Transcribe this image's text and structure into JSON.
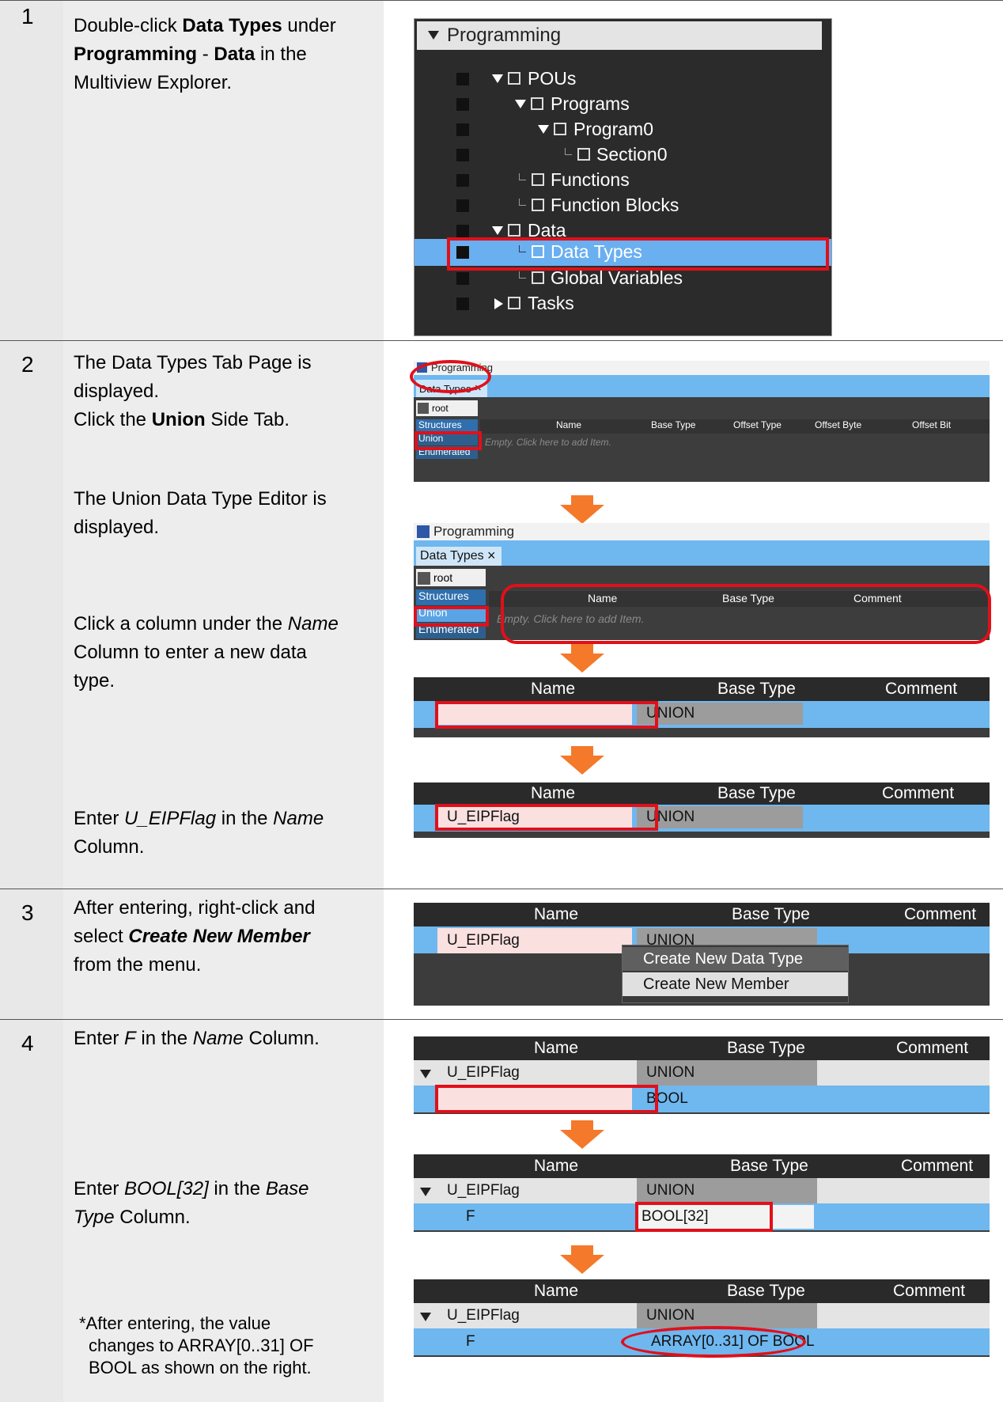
{
  "steps": [
    {
      "number": "1"
    },
    {
      "number": "2"
    },
    {
      "number": "3"
    },
    {
      "number": "4"
    }
  ],
  "step1": {
    "text_a": "Double-click ",
    "text_b": "Data Types",
    "text_c": " under",
    "text_d": "Programming",
    "text_e": " - ",
    "text_f": "Data",
    "text_g": " in the",
    "text_h": "Multiview Explorer."
  },
  "tree": {
    "header": "Programming",
    "items": [
      "POUs",
      "Programs",
      "Program0",
      "Section0",
      "Functions",
      "Function Blocks",
      "Data",
      "Data Types",
      "Global Variables",
      "Tasks"
    ]
  },
  "step2": {
    "a1": "The Data Types Tab Page is",
    "a2": "displayed.",
    "a3": "Click the ",
    "a4": "Union",
    "a5": " Side Tab.",
    "b1": "The Union Data Type Editor is",
    "b2": "displayed.",
    "c1": "Click a column under the ",
    "c2": "Name",
    "c3": "Column to enter a new data",
    "c4": "type.",
    "d1": "Enter ",
    "d2": "U_EIPFlag",
    "d3": " in the ",
    "d4": "Name",
    "d5": "Column."
  },
  "editor": {
    "title": "Programming",
    "tab": "Data Types",
    "tab_close": "×",
    "root": "root",
    "side_tabs": [
      "Structures",
      "Union",
      "Enumerated"
    ],
    "columns_struct": [
      "Name",
      "Base Type",
      "Offset Type",
      "Offset Byte",
      "Offset Bit"
    ],
    "columns_union": [
      "Name",
      "Base Type",
      "Comment"
    ],
    "empty_hint": "Empty. Click here to add Item."
  },
  "grid": {
    "col_name": "Name",
    "col_base": "Base Type",
    "col_comment": "Comment",
    "union": "UNION",
    "u_flag": "U_EIPFlag",
    "member": "F",
    "bool": "BOOL",
    "bool32": "BOOL[32]",
    "array": "ARRAY[0..31] OF BOOL"
  },
  "step3": {
    "a1": "After entering, right-click and",
    "a2": "select ",
    "a3": "Create New Member",
    "a4": "from the menu.",
    "menu": [
      "Create New Data Type",
      "Create New Member"
    ]
  },
  "step4": {
    "a1": "Enter ",
    "a2": "F",
    "a3": " in the ",
    "a4": "Name",
    "a5": " Column.",
    "b1": "Enter ",
    "b2": "BOOL[32]",
    "b3": " in the ",
    "b4": "Base",
    "b5": "Type",
    "b6": " Column.",
    "n1": "*After entering, the value",
    "n2": "changes to ARRAY[0..31] OF",
    "n3": "BOOL as shown on the right."
  }
}
